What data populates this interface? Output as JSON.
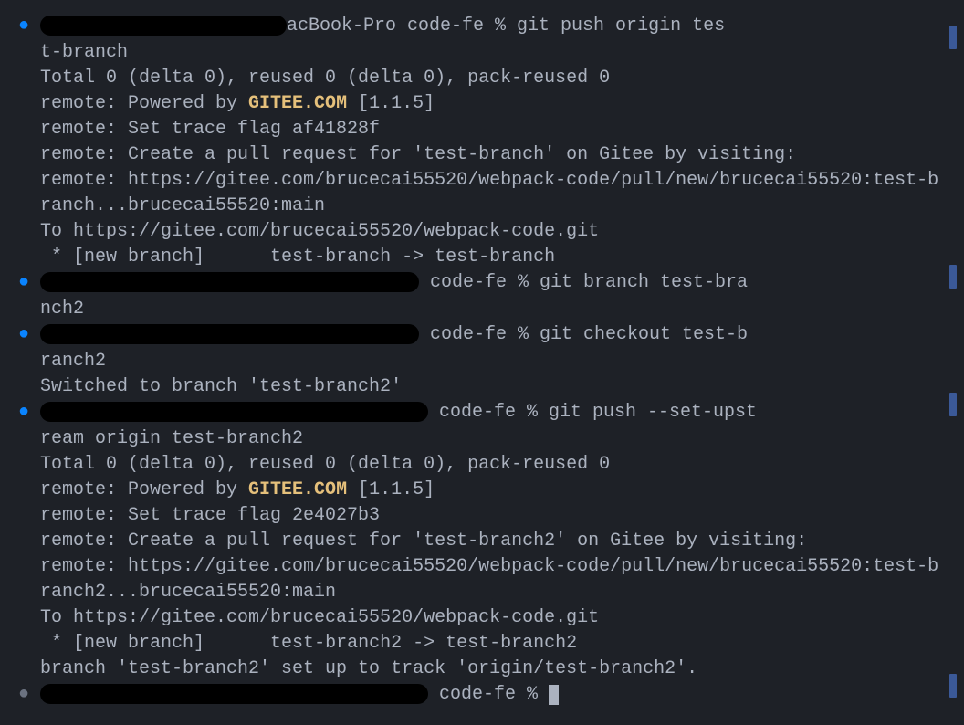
{
  "blocks": [
    {
      "bullet": "blue",
      "redactedWidth": 270,
      "promptSuffix": "acBook-Pro code-fe % git push origin tes",
      "wrapLines": [
        "t-branch"
      ],
      "output": [
        {
          "text": "Total 0 (delta 0), reused 0 (delta 0), pack-reused 0"
        },
        {
          "text": "remote: Powered by ",
          "highlighted": "GITEE.COM",
          "after": " [1.1.5]"
        },
        {
          "text": "remote: Set trace flag af41828f"
        },
        {
          "text": "remote: Create a pull request for 'test-branch' on Gitee by visiting:"
        },
        {
          "text": "remote: https://gitee.com/brucecai55520/webpack-code/pull/new/brucecai55520:test-branch...brucecai55520:main"
        },
        {
          "text": "To https://gitee.com/brucecai55520/webpack-code.git"
        },
        {
          "text": " * [new branch]      test-branch -> test-branch"
        }
      ]
    },
    {
      "bullet": "blue",
      "redactedWidth": 415,
      "promptSuffix": " code-fe % git branch test-bra",
      "wrapLines": [
        "nch2"
      ],
      "output": []
    },
    {
      "bullet": "blue",
      "redactedWidth": 415,
      "promptSuffix": " code-fe % git checkout test-b",
      "wrapLines": [
        "ranch2"
      ],
      "output": [
        {
          "text": "Switched to branch 'test-branch2'"
        }
      ]
    },
    {
      "bullet": "blue",
      "redactedWidth": 425,
      "promptSuffix": " code-fe % git push --set-upst",
      "wrapLines": [
        "ream origin test-branch2"
      ],
      "output": [
        {
          "text": "Total 0 (delta 0), reused 0 (delta 0), pack-reused 0"
        },
        {
          "text": "remote: Powered by ",
          "highlighted": "GITEE.COM",
          "after": " [1.1.5]"
        },
        {
          "text": "remote: Set trace flag 2e4027b3"
        },
        {
          "text": "remote: Create a pull request for 'test-branch2' on Gitee by visiting:"
        },
        {
          "text": "remote: https://gitee.com/brucecai55520/webpack-code/pull/new/brucecai55520:test-branch2...brucecai55520:main"
        },
        {
          "text": "To https://gitee.com/brucecai55520/webpack-code.git"
        },
        {
          "text": " * [new branch]      test-branch2 -> test-branch2"
        },
        {
          "text": "branch 'test-branch2' set up to track 'origin/test-branch2'."
        }
      ]
    },
    {
      "bullet": "grey",
      "redactedWidth": 425,
      "promptSuffix": " code-fe % ",
      "wrapLines": [],
      "output": [],
      "cursor": true
    }
  ],
  "scrollMarkers": [
    28,
    290,
    430,
    738
  ]
}
